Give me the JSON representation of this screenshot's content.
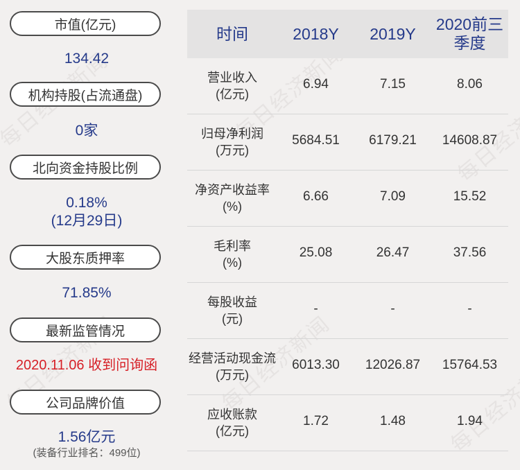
{
  "left_panel": {
    "items": [
      {
        "label": "市值(亿元)",
        "value": "134.42"
      },
      {
        "label": "机构持股(占流通盘)",
        "value": "0家"
      },
      {
        "label": "北向资金持股比例",
        "value": "0.18%",
        "value2": "(12月29日)"
      },
      {
        "label": "大股东质押率",
        "value": "71.85%"
      },
      {
        "label": "最新监管情况",
        "value": "2020.11.06 收到问询函"
      },
      {
        "label": "公司品牌价值",
        "value": "1.56亿元",
        "note": "(装备行业排名：499位)"
      }
    ]
  },
  "table": {
    "headers": [
      "时间",
      "2018Y",
      "2019Y",
      "2020前三季度"
    ],
    "rows": [
      {
        "label": "营业收入",
        "unit": "(亿元)",
        "values": [
          "6.94",
          "7.15",
          "8.06"
        ]
      },
      {
        "label": "归母净利润",
        "unit": "(万元)",
        "values": [
          "5684.51",
          "6179.21",
          "14608.87"
        ]
      },
      {
        "label": "净资产收益率",
        "unit": "(%)",
        "values": [
          "6.66",
          "7.09",
          "15.52"
        ]
      },
      {
        "label": "毛利率",
        "unit": "(%)",
        "values": [
          "25.08",
          "26.47",
          "37.56"
        ]
      },
      {
        "label": "每股收益",
        "unit": "(元)",
        "values": [
          "-",
          "-",
          "-"
        ]
      },
      {
        "label": "经营活动现金流",
        "unit": "(万元)",
        "values": [
          "6013.30",
          "12026.87",
          "15764.53"
        ]
      },
      {
        "label": "应收账款",
        "unit": "(亿元)",
        "values": [
          "1.72",
          "1.48",
          "1.94"
        ]
      }
    ]
  },
  "watermark": "每日经济新闻",
  "colors": {
    "background": "#f2f0ef",
    "value_blue": "#253a8a",
    "alert_red": "#d61f26",
    "header_bg": "#e4e3e3"
  }
}
